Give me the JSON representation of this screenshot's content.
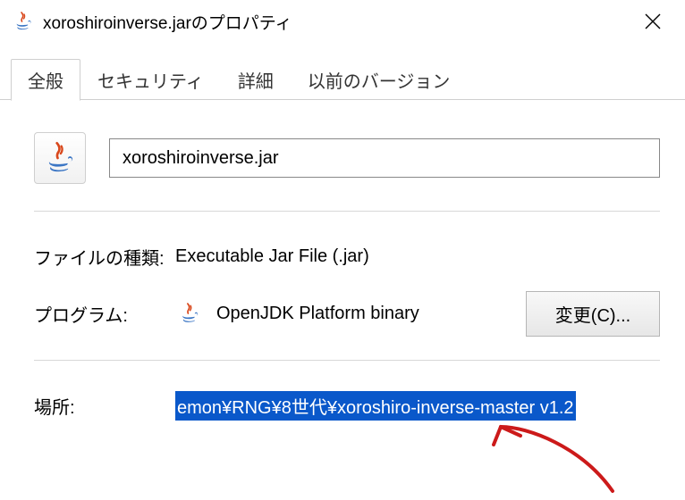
{
  "window": {
    "title": "xoroshiroinverse.jarのプロパティ"
  },
  "tabs": {
    "general": "全般",
    "security": "セキュリティ",
    "details": "詳細",
    "previous": "以前のバージョン"
  },
  "file": {
    "name": "xoroshiroinverse.jar"
  },
  "labels": {
    "filetype": "ファイルの種類:",
    "program": "プログラム:",
    "location": "場所:"
  },
  "values": {
    "filetype": "Executable Jar File (.jar)",
    "program": "OpenJDK Platform binary",
    "location": "emon¥RNG¥8世代¥xoroshiro-inverse-master v1.2"
  },
  "buttons": {
    "change": "変更(C)..."
  }
}
